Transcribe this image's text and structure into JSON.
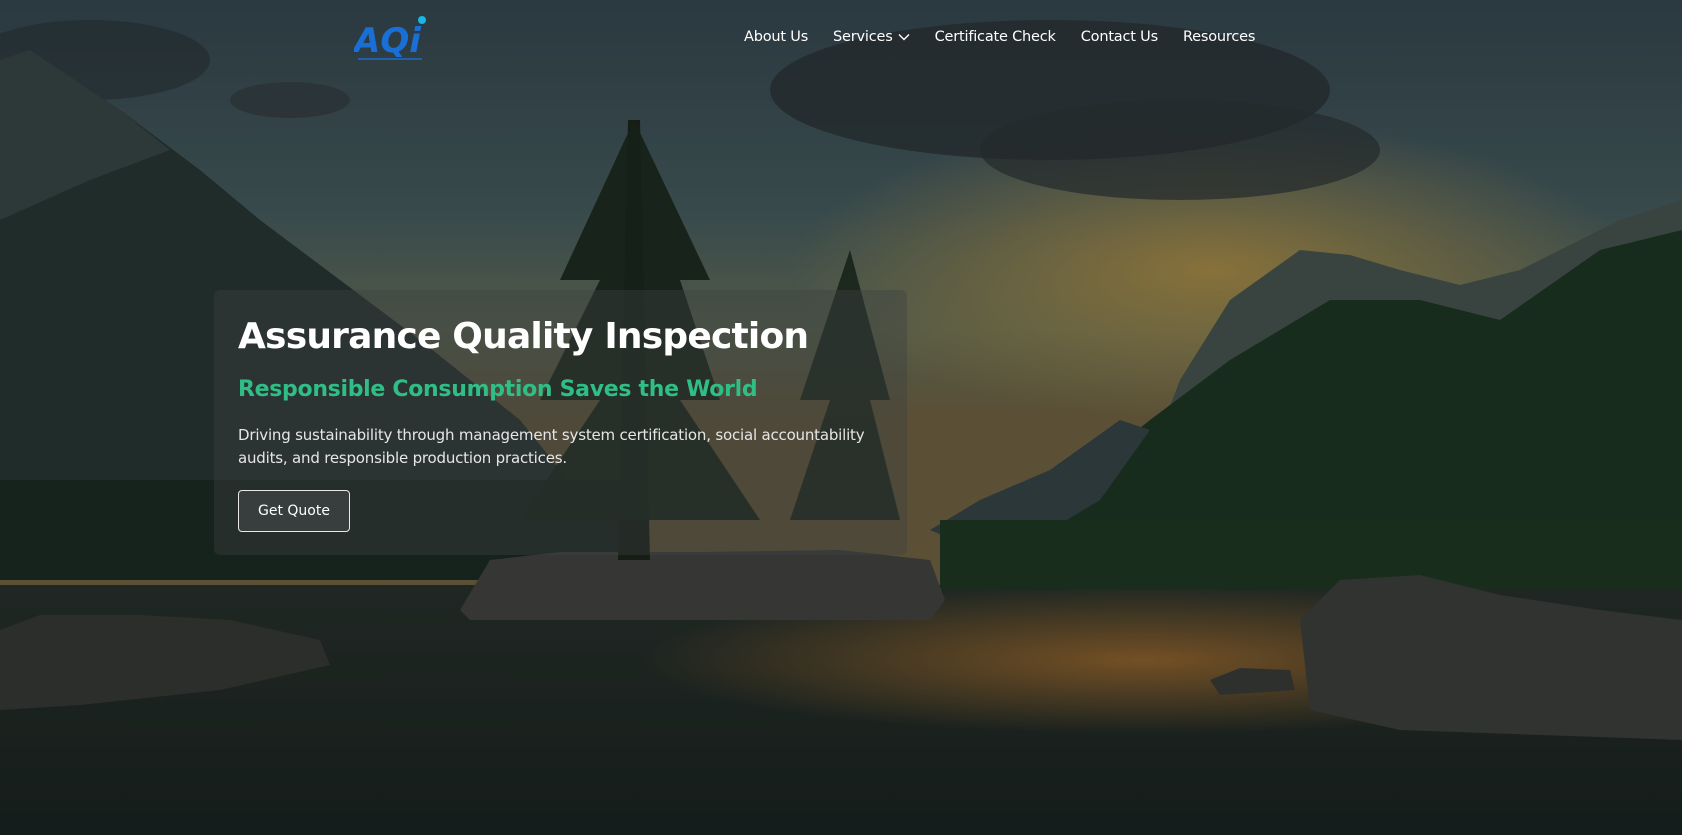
{
  "brand": {
    "logo_text": "AQi",
    "colors": {
      "accent": "#2fbf86",
      "logo_blue": "#1a6fd6",
      "logo_cyan": "#19b6e6"
    }
  },
  "nav": {
    "items": [
      {
        "label": "About Us"
      },
      {
        "label": "Services",
        "has_dropdown": true,
        "icon": "chevron-down-icon"
      },
      {
        "label": "Certificate Check"
      },
      {
        "label": "Contact Us"
      },
      {
        "label": "Resources"
      }
    ]
  },
  "hero": {
    "title": "Assurance Quality Inspection",
    "subtitle": "Responsible Consumption Saves the World",
    "description": "Driving sustainability through management system certification, social accountability audits, and responsible production practices.",
    "cta_label": "Get Quote"
  }
}
